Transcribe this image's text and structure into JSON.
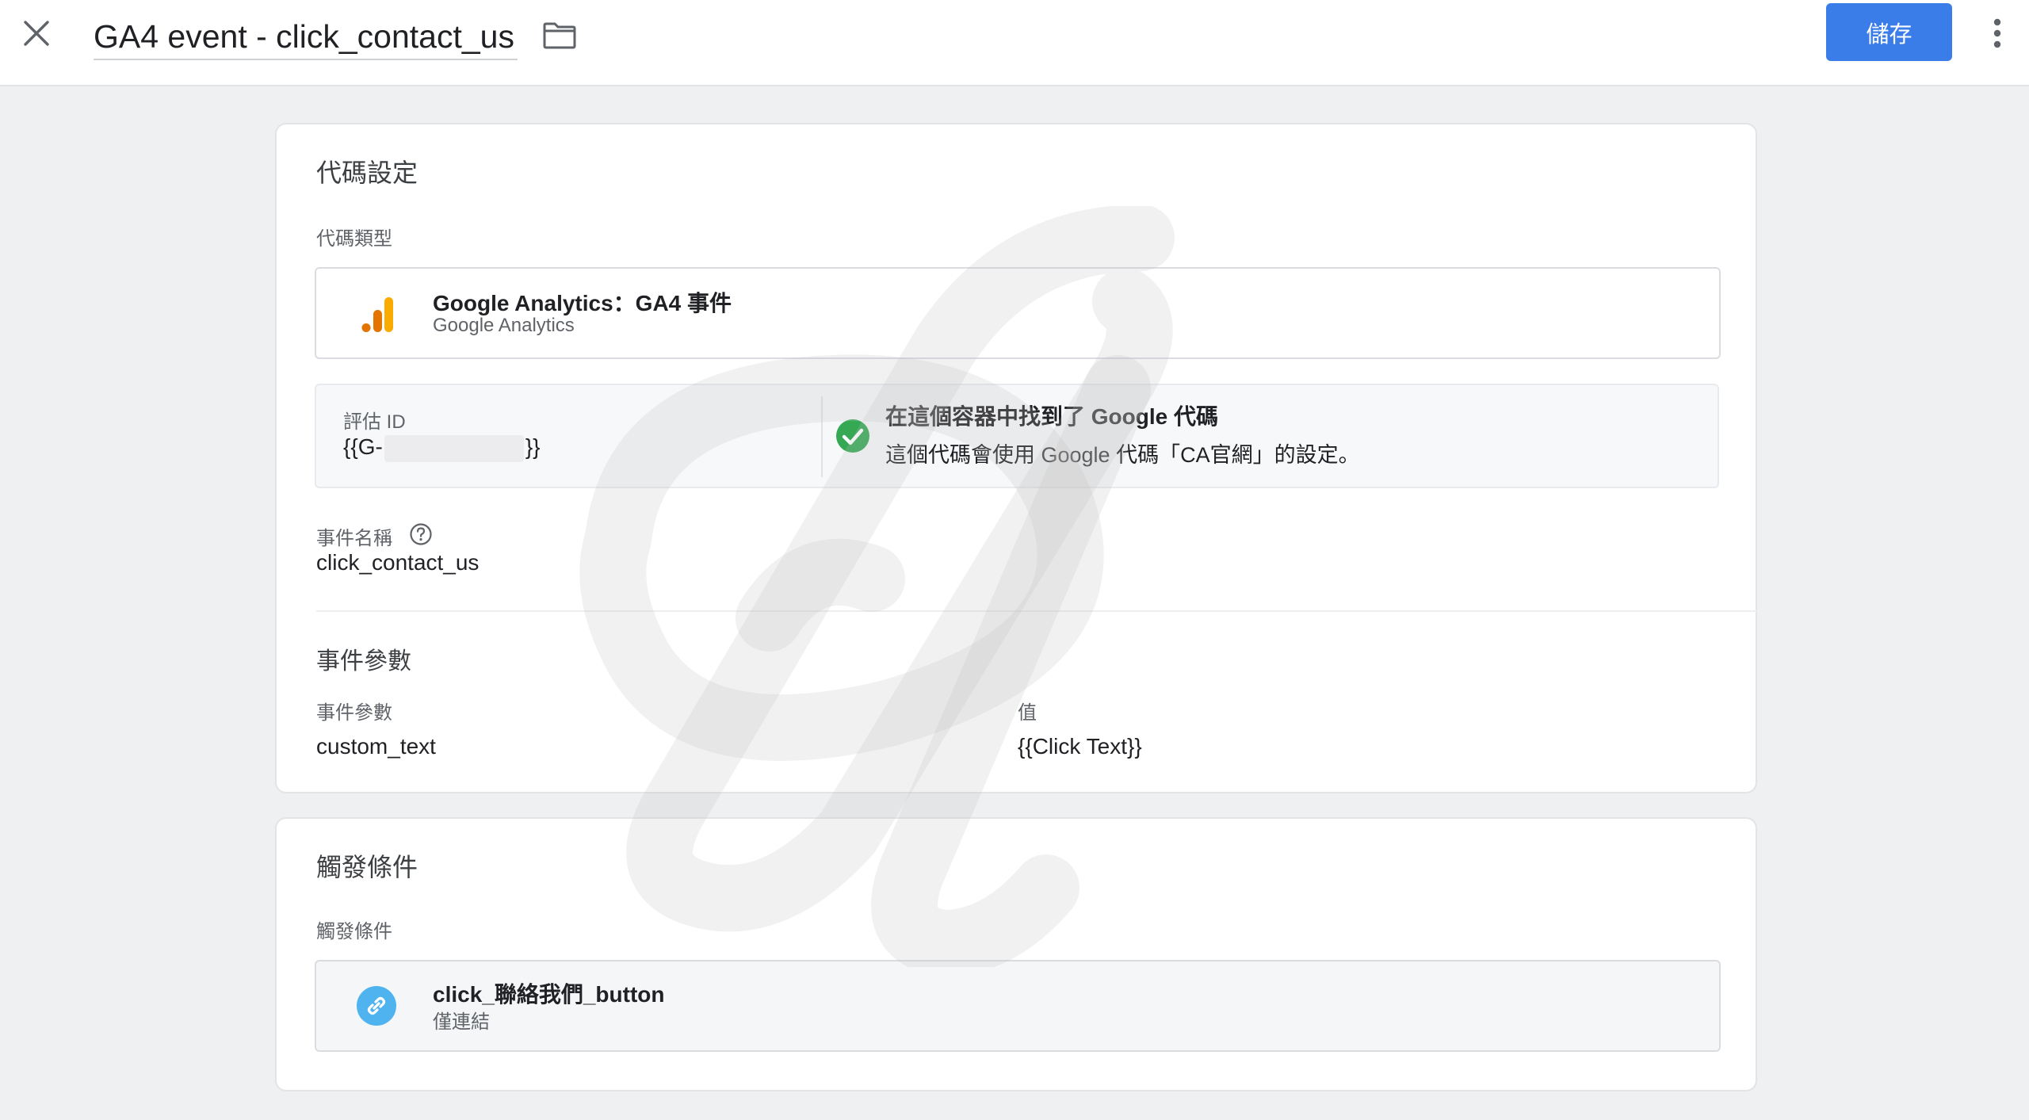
{
  "header": {
    "title": "GA4 event - click_contact_us",
    "save_label": "儲存"
  },
  "tag_config": {
    "section_title": "代碼設定",
    "tag_type_label": "代碼類型",
    "tag_type": {
      "name": "Google Analytics：GA4 事件",
      "vendor": "Google Analytics",
      "icon": "analytics-bars-icon"
    },
    "measurement_id": {
      "label": "評估 ID",
      "prefix": "{{G-",
      "suffix": "}}"
    },
    "google_tag_notice": {
      "title": "在這個容器中找到了 Google 代碼",
      "description": "這個代碼會使用 Google 代碼「CA官網」的設定。"
    },
    "event_name": {
      "label": "事件名稱",
      "value": "click_contact_us"
    },
    "event_params": {
      "section_title": "事件參數",
      "col_param": "事件參數",
      "col_value": "值",
      "rows": [
        {
          "param": "custom_text",
          "value": "{{Click Text}}"
        }
      ]
    }
  },
  "triggering": {
    "section_title": "觸發條件",
    "label": "觸發條件",
    "trigger": {
      "name": "click_聯絡我們_button",
      "type": "僅連結",
      "icon": "link-icon"
    }
  },
  "colors": {
    "accent": "#3a7de9",
    "success": "#34a853",
    "trigger_icon": "#4fb3f0",
    "analytics_orange": "#f9ab00",
    "analytics_dark_orange": "#e37400"
  }
}
